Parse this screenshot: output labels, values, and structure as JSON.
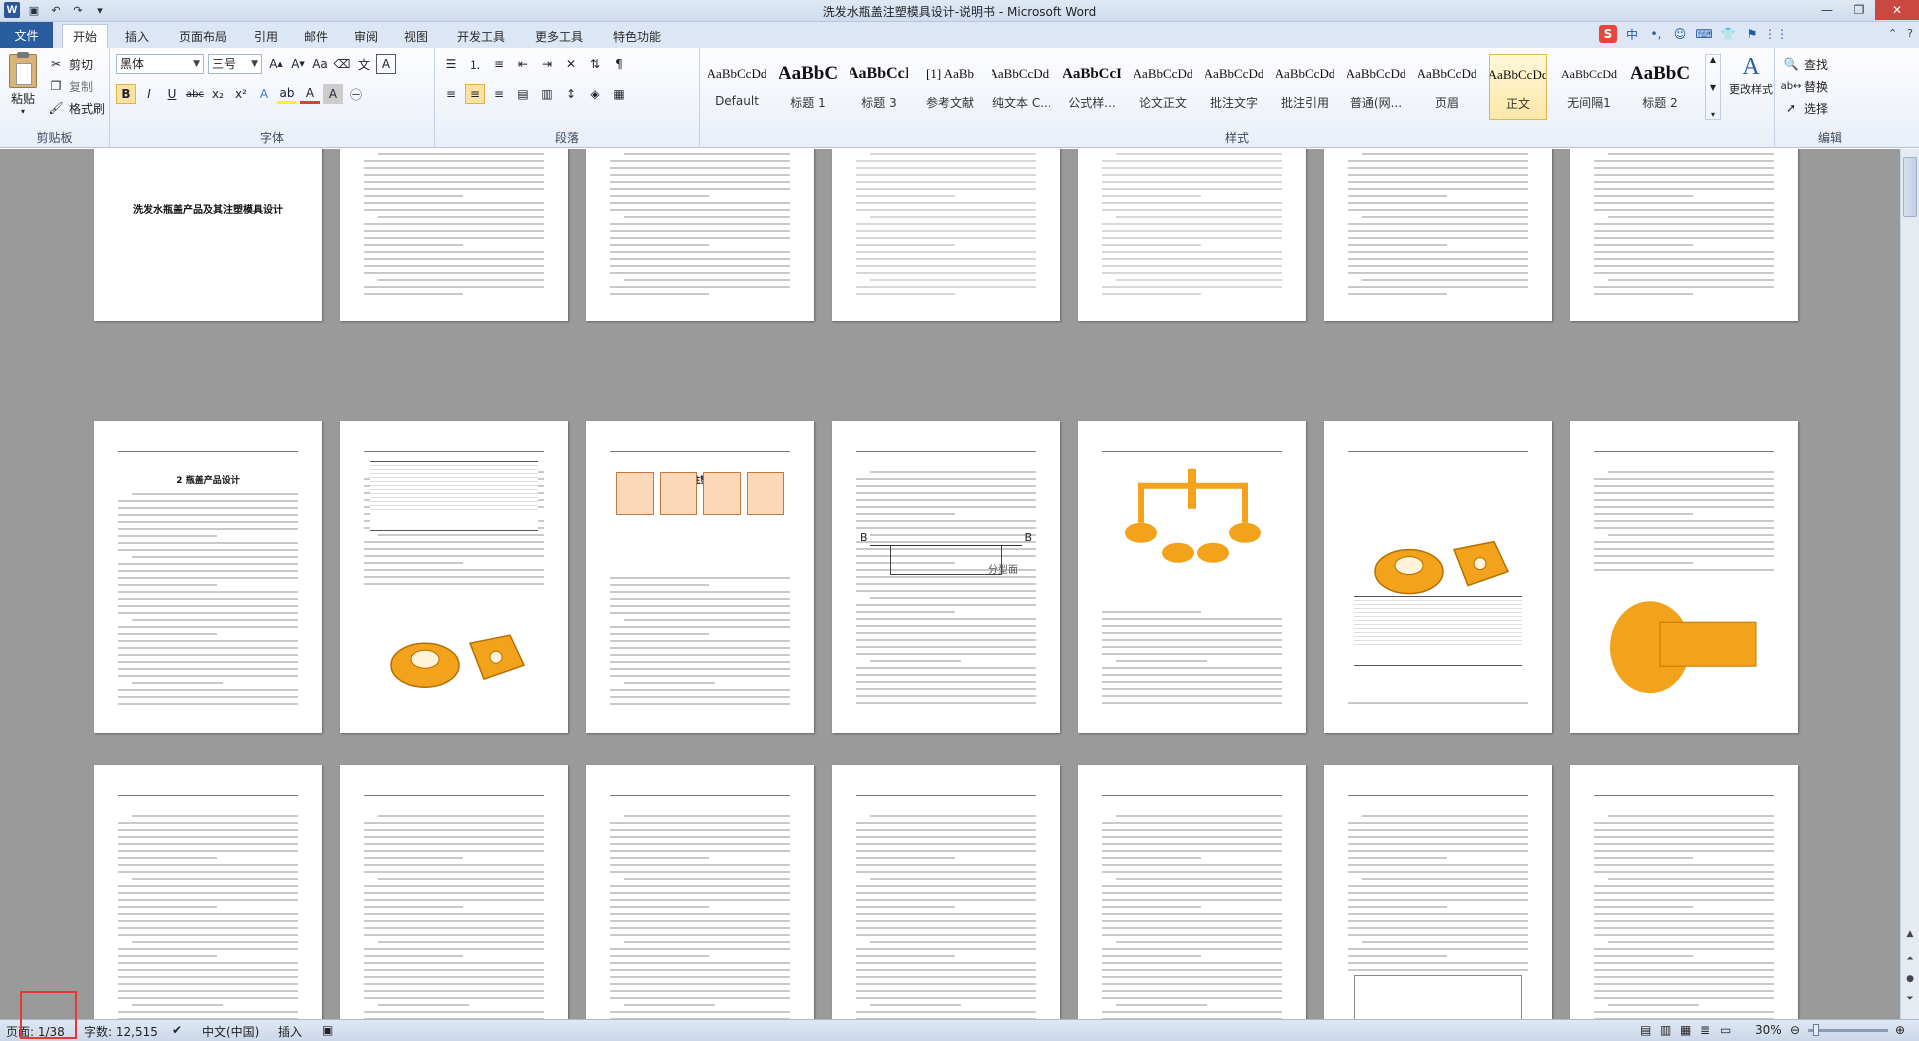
{
  "window": {
    "title": "洗发水瓶盖注塑模具设计-说明书 - Microsoft Word",
    "logo": "W",
    "controls": [
      "—",
      "❐",
      "✕"
    ]
  },
  "tabs": {
    "file": "文件",
    "items": [
      "开始",
      "插入",
      "页面布局",
      "引用",
      "邮件",
      "审阅",
      "视图",
      "开发工具",
      "更多工具",
      "特色功能"
    ],
    "active": "开始"
  },
  "ime": {
    "items": [
      "S",
      "中",
      "•,",
      "☺",
      "⌨",
      "👕",
      "⚑",
      "⋮⋮"
    ]
  },
  "ribbon": {
    "clipboard": {
      "label": "剪贴板",
      "paste": "粘贴",
      "cut": "剪切",
      "copy": "复制",
      "format_painter": "格式刷"
    },
    "font": {
      "label": "字体",
      "font_name": "黑体",
      "font_size": "三号"
    },
    "paragraph": {
      "label": "段落"
    },
    "styles": {
      "label": "样式",
      "change_styles": "更改样式",
      "items": [
        {
          "preview": "AaBbCcDd",
          "name": "Default"
        },
        {
          "preview": "AaBbC",
          "name": "标题 1"
        },
        {
          "preview": "AaBbCcI",
          "name": "标题 3"
        },
        {
          "preview": "[1] AaBb",
          "name": "参考文献"
        },
        {
          "preview": "AaBbCcDdI",
          "name": "纯文本 C..."
        },
        {
          "preview": "AaBbCcI",
          "name": "公式样..."
        },
        {
          "preview": "AaBbCcDd",
          "name": "论文正文"
        },
        {
          "preview": "AaBbCcDd",
          "name": "批注文字"
        },
        {
          "preview": "AaBbCcDd",
          "name": "批注引用"
        },
        {
          "preview": "AaBbCcDd",
          "name": "普通(网..."
        },
        {
          "preview": "AaBbCcDd",
          "name": "页眉"
        },
        {
          "preview": "AaBbCcDd",
          "name": "正文"
        },
        {
          "preview": "AaBbCcDd",
          "name": "无间隔1"
        },
        {
          "preview": "AaBbC",
          "name": "标题 2"
        }
      ],
      "active_index": 11
    },
    "editing": {
      "label": "编辑",
      "find": "查找",
      "replace": "替换",
      "select": "选择"
    }
  },
  "pages": {
    "p1_title": "洗发水瓶盖产品及其注塑模具设计",
    "p8_heading": "2 瓶盖产品设计",
    "p10_heading": "3 瓶盖注塑模设计",
    "fig_label_b1": "B",
    "fig_label_b2": "B",
    "fig_label_parting": "分型面"
  },
  "status": {
    "page": "页面: 1/38",
    "words": "字数: 12,515",
    "language": "中文(中国)",
    "mode": "插入",
    "zoom": "30%"
  },
  "colors": {
    "accent": "#2a5d9f",
    "part_orange": "#f2a31b",
    "highlight_red": "#e53935"
  }
}
